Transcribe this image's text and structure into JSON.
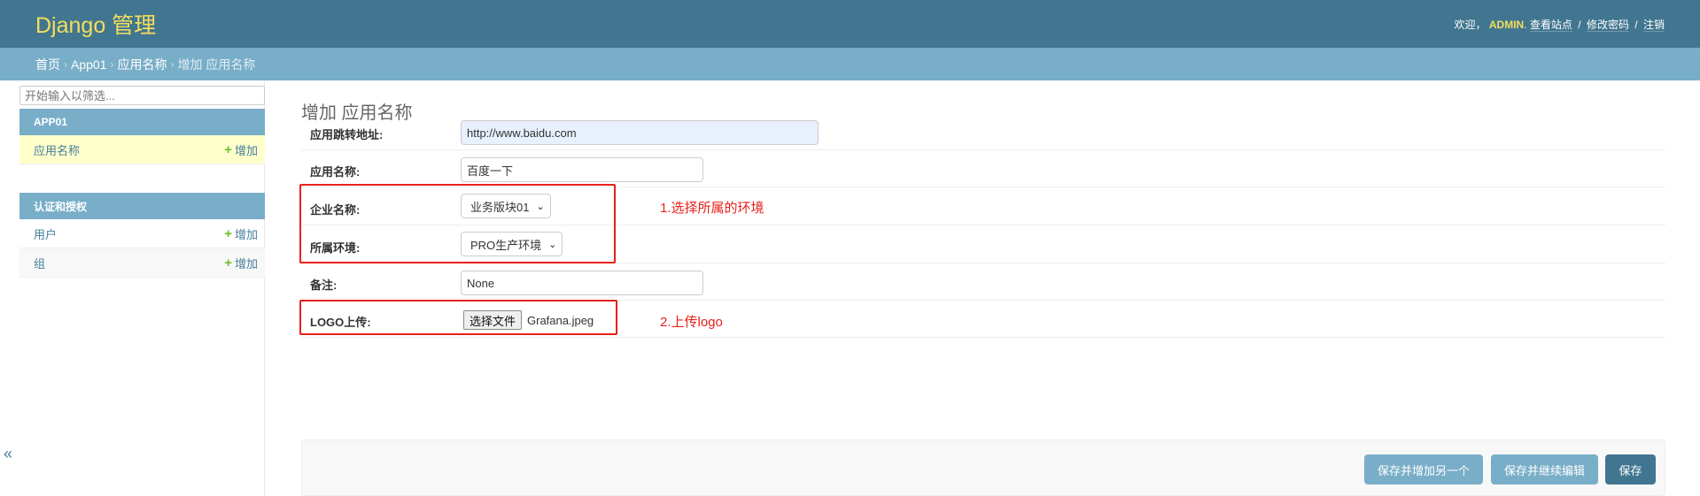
{
  "header": {
    "branding": "Django 管理",
    "welcome": "欢迎，",
    "username": "ADMIN",
    "view_site": "查看站点",
    "change_password": "修改密码",
    "logout": "注销",
    "sep": "/",
    "bg_color": "#417690",
    "brand_color": "#f5dd5d"
  },
  "breadcrumbs": {
    "home": "首页",
    "app": "App01",
    "model": "应用名称",
    "current": "增加 应用名称",
    "sep": "›"
  },
  "sidebar": {
    "filter_placeholder": "开始输入以筛选...",
    "apps": [
      {
        "caption": "APP01",
        "models": [
          {
            "name": "应用名称",
            "add_label": "增加",
            "current": true
          }
        ]
      },
      {
        "caption": "认证和授权",
        "models": [
          {
            "name": "用户",
            "add_label": "增加"
          },
          {
            "name": "组",
            "add_label": "增加"
          }
        ]
      }
    ],
    "toggle_icon": "«"
  },
  "main": {
    "title": "增加 应用名称",
    "fields": {
      "url": {
        "label": "应用跳转地址:",
        "value": "http://www.baidu.com"
      },
      "name": {
        "label": "应用名称:",
        "value": "百度一下"
      },
      "company": {
        "label": "企业名称:",
        "selected": "业务版块01"
      },
      "environment": {
        "label": "所属环境:",
        "selected": "PRO生产环境"
      },
      "remark": {
        "label": "备注:",
        "value": "None"
      },
      "logo": {
        "label": "LOGO上传:",
        "button": "选择文件",
        "file_name": "Grafana.jpeg"
      }
    },
    "annotations": {
      "note1": "1.选择所属的环境",
      "note2": "2.上传logo",
      "color": "#e8201a"
    },
    "buttons": {
      "save_add_another": "保存并增加另一个",
      "save_continue": "保存并继续编辑",
      "save": "保存"
    }
  }
}
